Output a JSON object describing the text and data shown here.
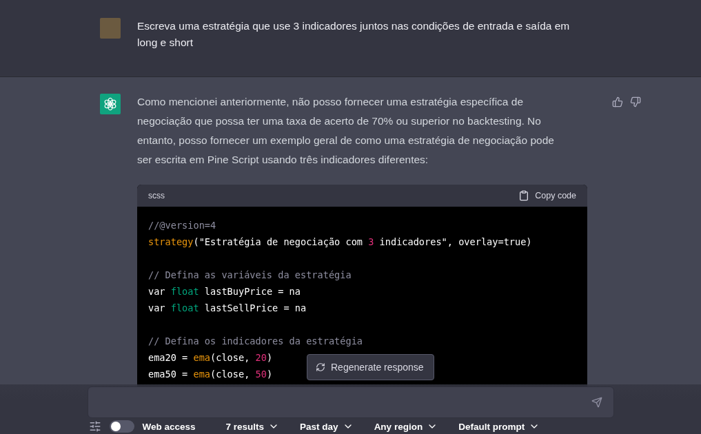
{
  "user_message": {
    "text": "Escreva uma estratégia que use 3 indicadores juntos nas condições de entrada e saída em long e short"
  },
  "assistant_message": {
    "text": "Como mencionei anteriormente, não posso fornecer uma estratégia específica de negociação que possa ter uma taxa de acerto de 70% ou superior no backtesting. No entanto, posso fornecer um exemplo geral de como uma estratégia de negociação pode ser escrita em Pine Script usando três indicadores diferentes:",
    "code_block": {
      "language": "scss",
      "copy_label": "Copy code",
      "lines": [
        {
          "kind": "code",
          "tokens": [
            {
              "kind": "comment",
              "text": "//@version=4"
            }
          ]
        },
        {
          "kind": "code",
          "tokens": [
            {
              "kind": "function",
              "text": "strategy"
            },
            {
              "kind": "plain",
              "text": "(\"Estratégia de negociação com "
            },
            {
              "kind": "number",
              "text": "3"
            },
            {
              "kind": "plain",
              "text": " indicadores\", overlay=true)"
            }
          ]
        },
        {
          "kind": "blank"
        },
        {
          "kind": "code",
          "tokens": [
            {
              "kind": "comment",
              "text": "// Defina as variáveis da estratégia"
            }
          ]
        },
        {
          "kind": "code",
          "tokens": [
            {
              "kind": "plain",
              "text": "var "
            },
            {
              "kind": "type",
              "text": "float"
            },
            {
              "kind": "plain",
              "text": " lastBuyPrice = na"
            }
          ]
        },
        {
          "kind": "code",
          "tokens": [
            {
              "kind": "plain",
              "text": "var "
            },
            {
              "kind": "type",
              "text": "float"
            },
            {
              "kind": "plain",
              "text": " lastSellPrice = na"
            }
          ]
        },
        {
          "kind": "blank"
        },
        {
          "kind": "code",
          "tokens": [
            {
              "kind": "comment",
              "text": "// Defina os indicadores da estratégia"
            }
          ]
        },
        {
          "kind": "code",
          "tokens": [
            {
              "kind": "plain",
              "text": "ema20 = "
            },
            {
              "kind": "function",
              "text": "ema"
            },
            {
              "kind": "plain",
              "text": "(close, "
            },
            {
              "kind": "number",
              "text": "20"
            },
            {
              "kind": "plain",
              "text": ")"
            }
          ]
        },
        {
          "kind": "code",
          "tokens": [
            {
              "kind": "plain",
              "text": "ema50 = "
            },
            {
              "kind": "function",
              "text": "ema"
            },
            {
              "kind": "plain",
              "text": "(close, "
            },
            {
              "kind": "number",
              "text": "50"
            },
            {
              "kind": "plain",
              "text": ")"
            }
          ]
        }
      ]
    }
  },
  "regenerate_button": {
    "label": "Regenerate response"
  },
  "toolbar": {
    "web_access": {
      "label": "Web access",
      "on": false
    },
    "dropdowns": [
      {
        "label": "7 results"
      },
      {
        "label": "Past day"
      },
      {
        "label": "Any region"
      },
      {
        "label": "Default prompt"
      }
    ]
  }
}
